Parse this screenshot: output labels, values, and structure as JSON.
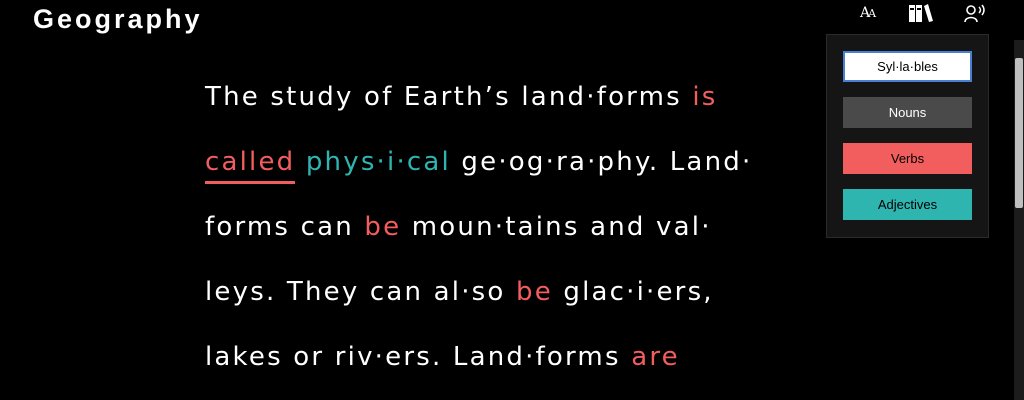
{
  "header": {
    "title": "Geography"
  },
  "toolbar": {
    "text_size_big": "A",
    "text_size_small": "A",
    "icons": [
      "text-size-icon",
      "library-icon",
      "read-aloud-icon"
    ]
  },
  "reading": {
    "line1": {
      "a": "The study of Earth’s land·forms ",
      "b": "is"
    },
    "line2": {
      "a": "called",
      "b": " ",
      "c": "phys·i·cal",
      "d": " ge·og·ra·phy. Land·"
    },
    "line3": {
      "a": "forms can ",
      "b": "be",
      "c": " moun·tains and val·"
    },
    "line4": {
      "a": "leys. They can al·so ",
      "b": "be",
      "c": " glac·i·ers,"
    },
    "line5": {
      "a": "lakes or riv·ers. Land·forms ",
      "b": "are"
    }
  },
  "panel": {
    "syllables_label": "Syl·la·bles",
    "nouns_label": "Nouns",
    "verbs_label": "Verbs",
    "adjectives_label": "Adjectives"
  },
  "colors": {
    "verb": "#f25d5d",
    "adjective": "#2fb5b0",
    "noun": "#4a4a4a",
    "background": "#000000"
  }
}
